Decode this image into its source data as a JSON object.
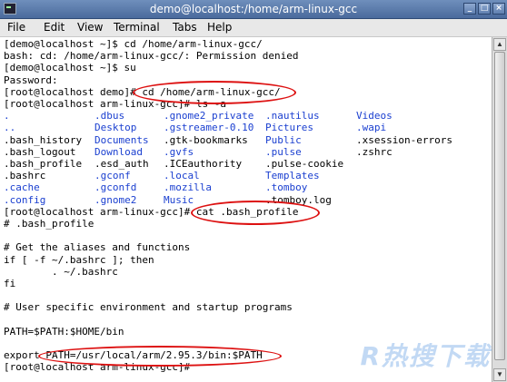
{
  "window": {
    "title": "demo@localhost:/home/arm-linux-gcc"
  },
  "menu": [
    "File",
    "Edit",
    "View",
    "Terminal",
    "Tabs",
    "Help"
  ],
  "lines_top": [
    "[demo@localhost ~]$ cd /home/arm-linux-gcc/",
    "bash: cd: /home/arm-linux-gcc/: Permission denied",
    "[demo@localhost ~]$ su",
    "Password:",
    "[root@localhost demo]# cd /home/arm-linux-gcc/",
    "[root@localhost arm-linux-gcc]# ls -a"
  ],
  "listing": [
    [
      ".",
      ".dbus",
      ".gnome2_private",
      ".nautilus",
      "Videos"
    ],
    [
      "..",
      "Desktop",
      ".gstreamer-0.10",
      "Pictures",
      ".wapi"
    ],
    [
      ".bash_history",
      "Documents",
      ".gtk-bookmarks",
      "Public",
      ".xsession-errors"
    ],
    [
      ".bash_logout",
      "Download",
      ".gvfs",
      ".pulse",
      ".zshrc"
    ],
    [
      ".bash_profile",
      ".esd_auth",
      ".ICEauthority",
      ".pulse-cookie",
      ""
    ],
    [
      ".bashrc",
      ".gconf",
      ".local",
      "Templates",
      ""
    ],
    [
      ".cache",
      ".gconfd",
      ".mozilla",
      ".tomboy",
      ""
    ],
    [
      ".config",
      ".gnome2",
      "Music",
      ".tomboy.log",
      ""
    ]
  ],
  "lines_bottom": [
    "[root@localhost arm-linux-gcc]# cat .bash_profile",
    "# .bash_profile",
    "",
    "# Get the aliases and functions",
    "if [ -f ~/.bashrc ]; then",
    "        . ~/.bashrc",
    "fi",
    "",
    "# User specific environment and startup programs",
    "",
    "PATH=$PATH:$HOME/bin",
    "",
    "export PATH=/usr/local/arm/2.95.3/bin:$PATH",
    "[root@localhost arm-linux-gcc]# "
  ],
  "watermark": "R热搜下载",
  "colors": {
    "dir": "#1a3fd0",
    "annotation": "#dd1111"
  }
}
